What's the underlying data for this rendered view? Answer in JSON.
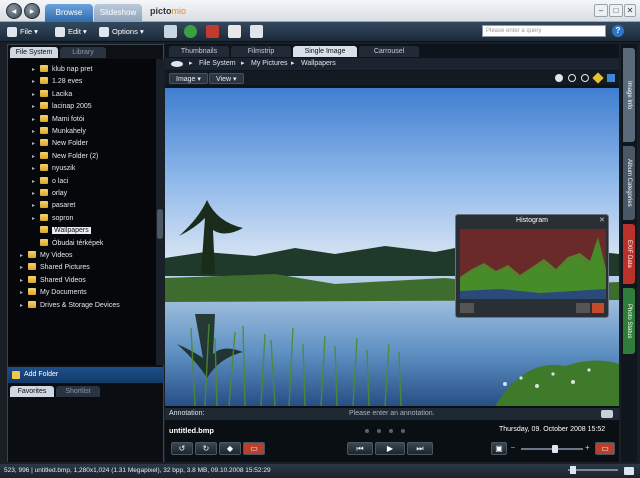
{
  "titlebar": {
    "tabs": [
      "Browse",
      "Slideshow"
    ],
    "logo_main": "picto",
    "logo_accent": "mio"
  },
  "toolbar": {
    "file_label": "File",
    "edit_label": "Edit",
    "options_label": "Options",
    "search_placeholder": "Please enter a query"
  },
  "left_panel": {
    "tabs": [
      "File System",
      "Library"
    ],
    "tree": [
      {
        "label": "klub nap pret",
        "level": 2,
        "expand": "▸"
      },
      {
        "label": "1.28 eves",
        "level": 2,
        "expand": "▸"
      },
      {
        "label": "Lacika",
        "level": 2,
        "expand": "▸"
      },
      {
        "label": "lacinap 2005",
        "level": 2,
        "expand": "▸"
      },
      {
        "label": "Mami fotói",
        "level": 2,
        "expand": "▸"
      },
      {
        "label": "Munkahely",
        "level": 2,
        "expand": "▸"
      },
      {
        "label": "New Folder",
        "level": 2,
        "expand": "▸"
      },
      {
        "label": "New Folder (2)",
        "level": 2,
        "expand": "▸"
      },
      {
        "label": "nyuszik",
        "level": 2,
        "expand": "▸"
      },
      {
        "label": "o laci",
        "level": 2,
        "expand": "▸"
      },
      {
        "label": "orlay",
        "level": 2,
        "expand": "▸"
      },
      {
        "label": "pasaret",
        "level": 2,
        "expand": "▸"
      },
      {
        "label": "sopron",
        "level": 2,
        "expand": "▸"
      },
      {
        "label": "Wallpapers",
        "level": 2,
        "expand": "",
        "selected": true
      },
      {
        "label": "Óbudai térképek",
        "level": 2,
        "expand": ""
      },
      {
        "label": "My Videos",
        "level": 1,
        "expand": "▸"
      },
      {
        "label": "Shared Pictures",
        "level": 1,
        "expand": "▸"
      },
      {
        "label": "Shared Videos",
        "level": 1,
        "expand": "▸"
      },
      {
        "label": "My Documents",
        "level": 1,
        "expand": "▸"
      },
      {
        "label": "Drives & Storage Devices",
        "level": 1,
        "expand": "▸"
      }
    ],
    "add_folder": "Add Folder",
    "bottom_tabs": [
      "Favorites",
      "Shortlist"
    ]
  },
  "center": {
    "view_tabs": [
      "Thumbnails",
      "Filmstrip",
      "Single Image",
      "Carrousel"
    ],
    "active_view": 2,
    "breadcrumb": [
      "File System",
      "My Pictures",
      "Wallpapers"
    ],
    "menus": [
      "Image",
      "View"
    ],
    "histogram_title": "Histogram",
    "annotation_label": "Annotation:",
    "annotation_placeholder": "Please enter an annotation.",
    "filename": "untitled.bmp",
    "date": "Thursday, 09. October 2008 15:52",
    "zoom_percent": 55
  },
  "right_tabs": [
    {
      "label": "Image Info",
      "color": "#5a6a7a"
    },
    {
      "label": "Album Categories",
      "color": "#4a5866"
    },
    {
      "label": "EXIF Data",
      "color": "#b8322a"
    },
    {
      "label": "Photo Status",
      "color": "#2e7d3a"
    }
  ],
  "status": {
    "text": "523, 996 | untitled.bmp, 1,280x1,024 (1.31 Megapixel), 32 bpp, 3.8 MB, 09.10.2008 15:52:29"
  }
}
